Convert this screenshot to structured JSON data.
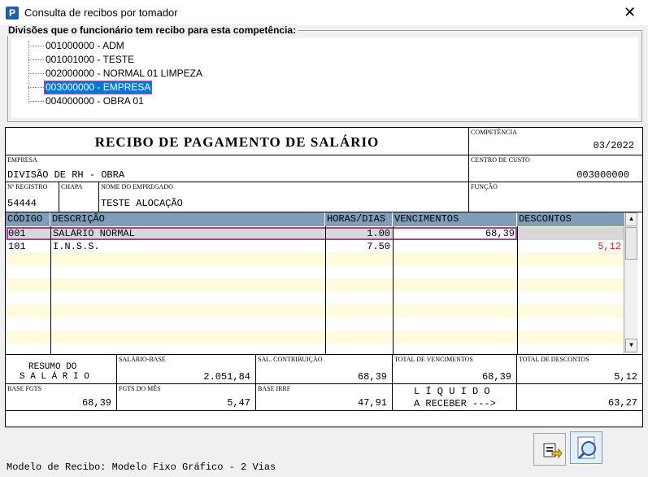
{
  "window": {
    "title": "Consulta de recibos por tomador",
    "app_icon": "P",
    "close_label": "✕"
  },
  "divisions": {
    "group_label": "Divisões que o funcionário tem recibo para esta competência:",
    "items": [
      {
        "label": "001000000 - ADM",
        "selected": false
      },
      {
        "label": "001001000 - TESTE",
        "selected": false
      },
      {
        "label": "002000000 - NORMAL 01 LIMPEZA",
        "selected": false
      },
      {
        "label": "003000000 - EMPRESA",
        "selected": true
      },
      {
        "label": "004000000 - OBRA 01",
        "selected": false
      }
    ]
  },
  "receipt": {
    "title": "RECIBO DE PAGAMENTO DE SALÁRIO",
    "competencia_label": "COMPETÊNCIA",
    "competencia_value": "03/2022",
    "empresa_label": "EMPRESA",
    "empresa_value": "DIVISÃO DE RH - OBRA",
    "centro_custo_label": "CENTRO DE CUSTO",
    "centro_custo_value": "003000000",
    "registro_label": "Nº REGISTRO",
    "registro_value": "54444",
    "chapa_label": "CHAPA",
    "chapa_value": "",
    "nome_label": "NOME DO EMPREGADO",
    "nome_value": "TESTE ALOCAÇÃO",
    "funcao_label": "FUNÇÃO",
    "funcao_value": ""
  },
  "grid": {
    "columns": [
      "CÓDIGO",
      "DESCRIÇÃO",
      "HORAS/DIAS",
      "VENCIMENTOS",
      "DESCONTOS"
    ],
    "rows": [
      {
        "codigo": "001",
        "descricao": "SALÁRIO NORMAL",
        "horas": "1.00",
        "vencimentos": "68,39",
        "descontos": ""
      },
      {
        "codigo": "101",
        "descricao": "I.N.S.S.",
        "horas": "7.50",
        "vencimentos": "",
        "descontos": "5,12"
      }
    ],
    "discount_color": "#e02020"
  },
  "summary": {
    "resumo_line1": "RESUMO DO",
    "resumo_line2": "S A L Á R I O",
    "salario_base_label": "SALÁRIO-BASE",
    "salario_base_value": "2.051,84",
    "sal_contrib_label": "SAL. CONTRIBUIÇÃO",
    "sal_contrib_value": "68,39",
    "total_venc_label": "TOTAL DE VENCIMENTOS",
    "total_venc_value": "68,39",
    "total_desc_label": "TOTAL DE DESCONTOS",
    "total_desc_value": "5,12",
    "base_fgts_label": "BASE FGTS",
    "base_fgts_value": "68,39",
    "fgts_mes_label": "FGTS DO MÊS",
    "fgts_mes_value": "5,47",
    "base_irrf_label": "BASE IRRF",
    "base_irrf_value": "47,91",
    "liquido_line1": "L Í Q U I D O",
    "liquido_line2": "A RECEBER --->",
    "liquido_value": "63,27"
  },
  "footer": {
    "modelo_text": "Modelo de Recibo: Modelo Fixo Gráfico - 2 Vias",
    "buttons": [
      {
        "icon": "export-icon"
      },
      {
        "icon": "search-magnifier-icon"
      }
    ]
  }
}
